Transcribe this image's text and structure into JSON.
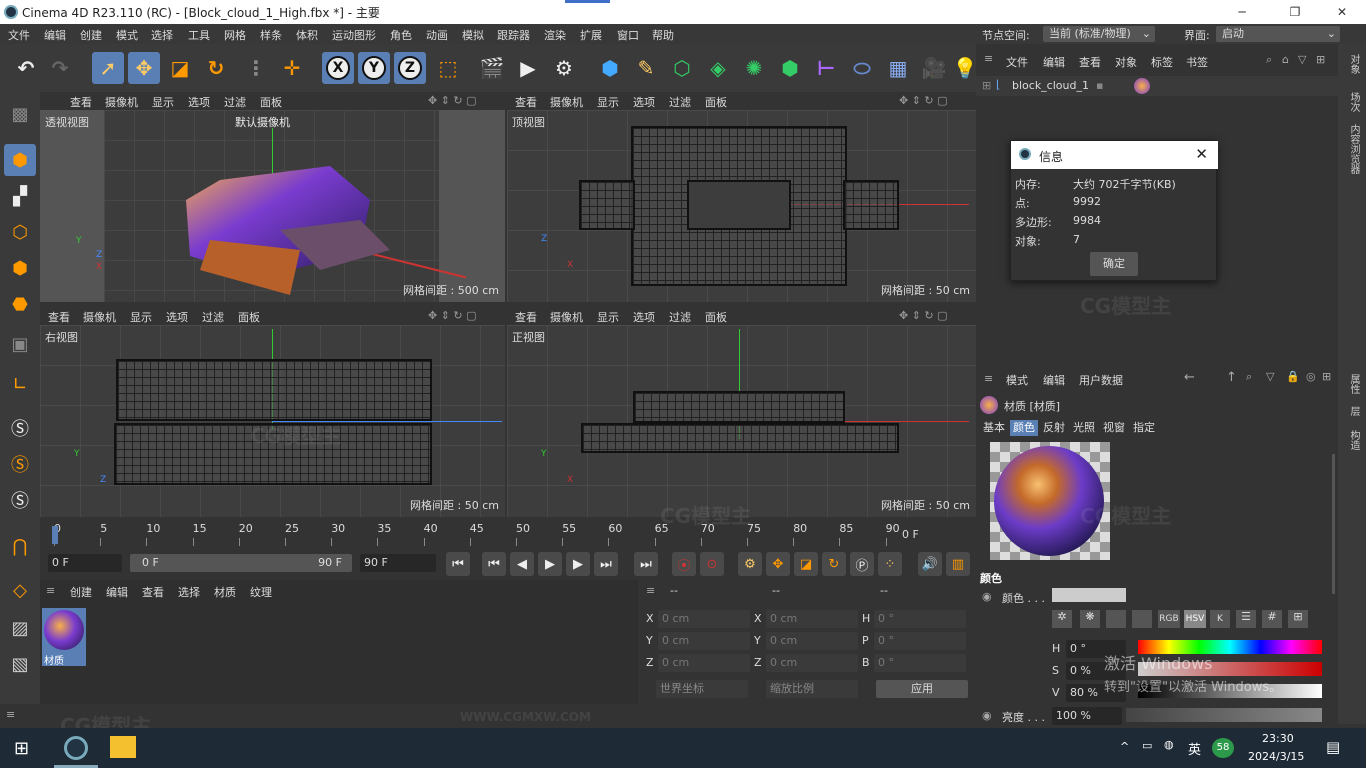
{
  "app": {
    "title": "Cinema 4D R23.110 (RC) - [Block_cloud_1_High.fbx *] - 主要",
    "minimize": "─",
    "restore": "❐",
    "close": "✕"
  },
  "menu": [
    "文件",
    "编辑",
    "创建",
    "模式",
    "选择",
    "工具",
    "网格",
    "样条",
    "体积",
    "运动图形",
    "角色",
    "动画",
    "模拟",
    "跟踪器",
    "渲染",
    "扩展",
    "窗口",
    "帮助"
  ],
  "node_space": {
    "label": "节点空间:",
    "value": "当前 (标准/物理)"
  },
  "interface": {
    "label": "界面:",
    "value": "启动"
  },
  "toolbar": {
    "x": "X",
    "y": "Y",
    "z": "Z"
  },
  "viewport_menu": [
    "查看",
    "摄像机",
    "显示",
    "选项",
    "过滤",
    "面板"
  ],
  "viewports": {
    "perspective": {
      "label": "透视视图",
      "camera": "默认摄像机",
      "grid": "网格间距 : 500 cm"
    },
    "top": {
      "label": "顶视图",
      "grid": "网格间距 : 50 cm"
    },
    "right": {
      "label": "右视图",
      "grid": "网格间距 : 50 cm"
    },
    "front": {
      "label": "正视图",
      "grid": "网格间距 : 50 cm"
    }
  },
  "axis": {
    "x": "X",
    "y": "Y",
    "z": "Z"
  },
  "timeline": {
    "ticks": [
      "0",
      "5",
      "10",
      "15",
      "20",
      "25",
      "30",
      "35",
      "40",
      "45",
      "50",
      "55",
      "60",
      "65",
      "70",
      "75",
      "80",
      "85",
      "90"
    ],
    "current": "0 F"
  },
  "playback": {
    "start": "0 F",
    "range_start": "0 F",
    "range_end": "90 F",
    "end": "90 F"
  },
  "material_manager": {
    "menu": [
      "创建",
      "编辑",
      "查看",
      "选择",
      "材质",
      "纹理"
    ],
    "material_name": "材质"
  },
  "coordinates": {
    "header": [
      "--",
      "--",
      "--"
    ],
    "rows": [
      {
        "a": "X",
        "av": "0 cm",
        "b": "X",
        "bv": "0 cm",
        "c": "H",
        "cv": "0 °"
      },
      {
        "a": "Y",
        "av": "0 cm",
        "b": "Y",
        "bv": "0 cm",
        "c": "P",
        "cv": "0 °"
      },
      {
        "a": "Z",
        "av": "0 cm",
        "b": "Z",
        "bv": "0 cm",
        "c": "B",
        "cv": "0 °"
      }
    ],
    "world": "世界坐标",
    "scale": "缩放比例",
    "apply": "应用"
  },
  "object_manager": {
    "menu": [
      "文件",
      "编辑",
      "查看",
      "对象",
      "标签",
      "书签"
    ],
    "object": "block_cloud_1"
  },
  "info_dialog": {
    "title": "信息",
    "memory_label": "内存:",
    "memory": "大约 702千字节(KB)",
    "points_label": "点:",
    "points": "9992",
    "polys_label": "多边形:",
    "polys": "9984",
    "objects_label": "对象:",
    "objects": "7",
    "ok": "确定"
  },
  "attribute_manager": {
    "menu": [
      "模式",
      "编辑",
      "用户数据"
    ],
    "title": "材质 [材质]",
    "tabs": [
      "基本",
      "颜色",
      "反射",
      "光照",
      "视窗",
      "指定"
    ],
    "section": "颜色",
    "color_label": "颜色 . . .",
    "modes": [
      "RGB",
      "HSV",
      "K"
    ],
    "h_label": "H",
    "h": "0 °",
    "s_label": "S",
    "s": "0 %",
    "v_label": "V",
    "v": "80 %",
    "brightness_label": "亮度 . . .",
    "brightness": "100 %"
  },
  "right_strip": [
    "对象",
    "场次",
    "内容浏览器",
    "属性",
    "层",
    "构造"
  ],
  "watermark": {
    "text": "CG模型主",
    "url": "WWW.CGMXW.COM"
  },
  "activation": {
    "line1": "激活 Windows",
    "line2": "转到\"设置\"以激活 Windows。"
  },
  "taskbar": {
    "ime": "英",
    "badge": "58",
    "time": "23:30",
    "date": "2024/3/15"
  },
  "colors": {
    "selected": "#5a7fb5",
    "accent_blue": "#3f6fc8"
  }
}
